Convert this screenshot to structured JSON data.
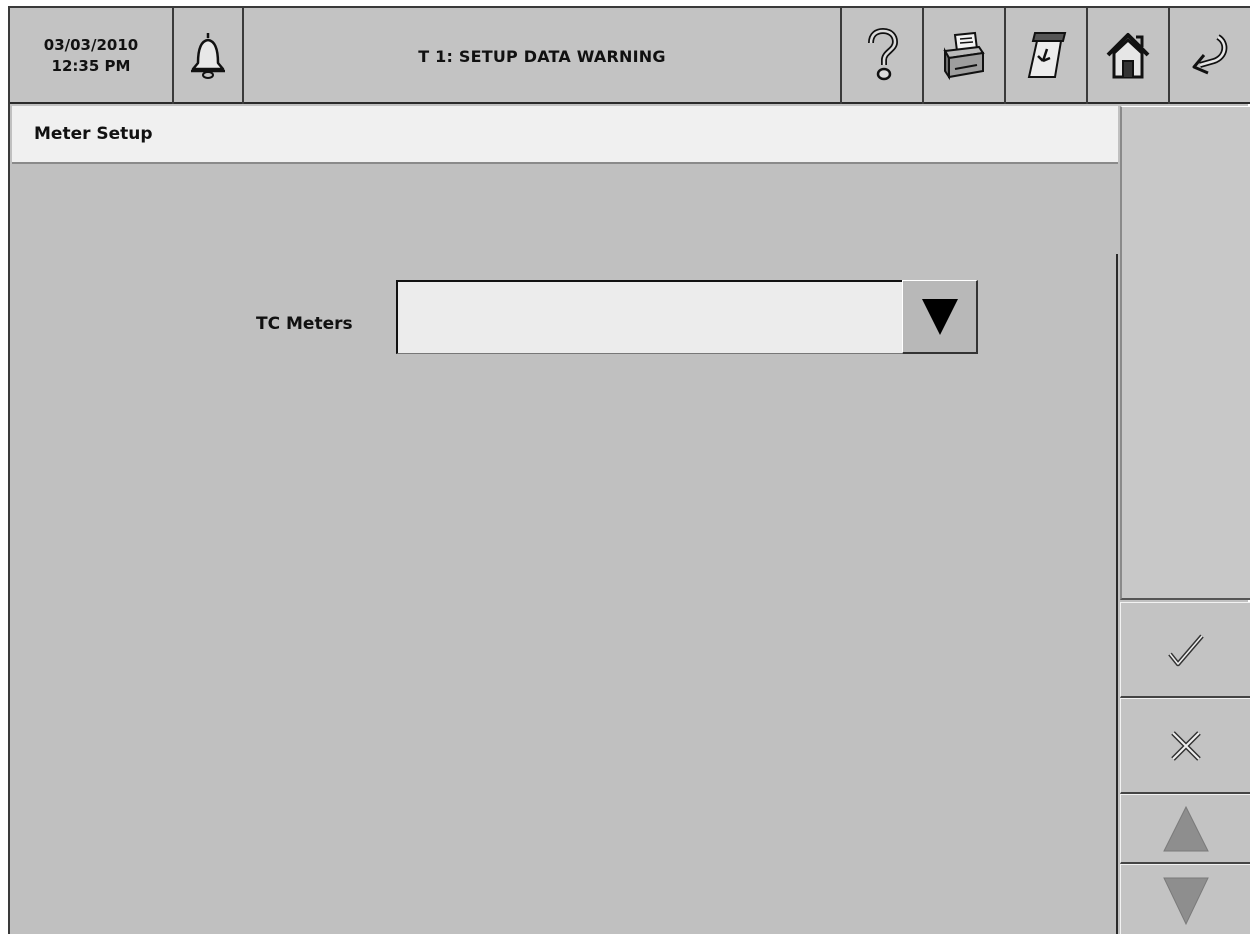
{
  "topbar": {
    "date": "03/03/2010",
    "time": "12:35 PM",
    "title": "T 1: SETUP DATA WARNING",
    "icons": [
      "bell-icon",
      "help-icon",
      "print-icon",
      "receipt-icon",
      "home-icon",
      "back-icon"
    ]
  },
  "header": {
    "title": "Meter Setup"
  },
  "form": {
    "tc_meters": {
      "label": "TC Meters",
      "value": ""
    }
  },
  "sidebar": {
    "icons": [
      "check-icon",
      "cancel-x-icon",
      "arrow-up-icon",
      "arrow-down-icon"
    ]
  },
  "colors": {
    "background": "#c0c0c0",
    "panel_light": "#f0f0f0",
    "border_dark": "#2a2a2a"
  }
}
